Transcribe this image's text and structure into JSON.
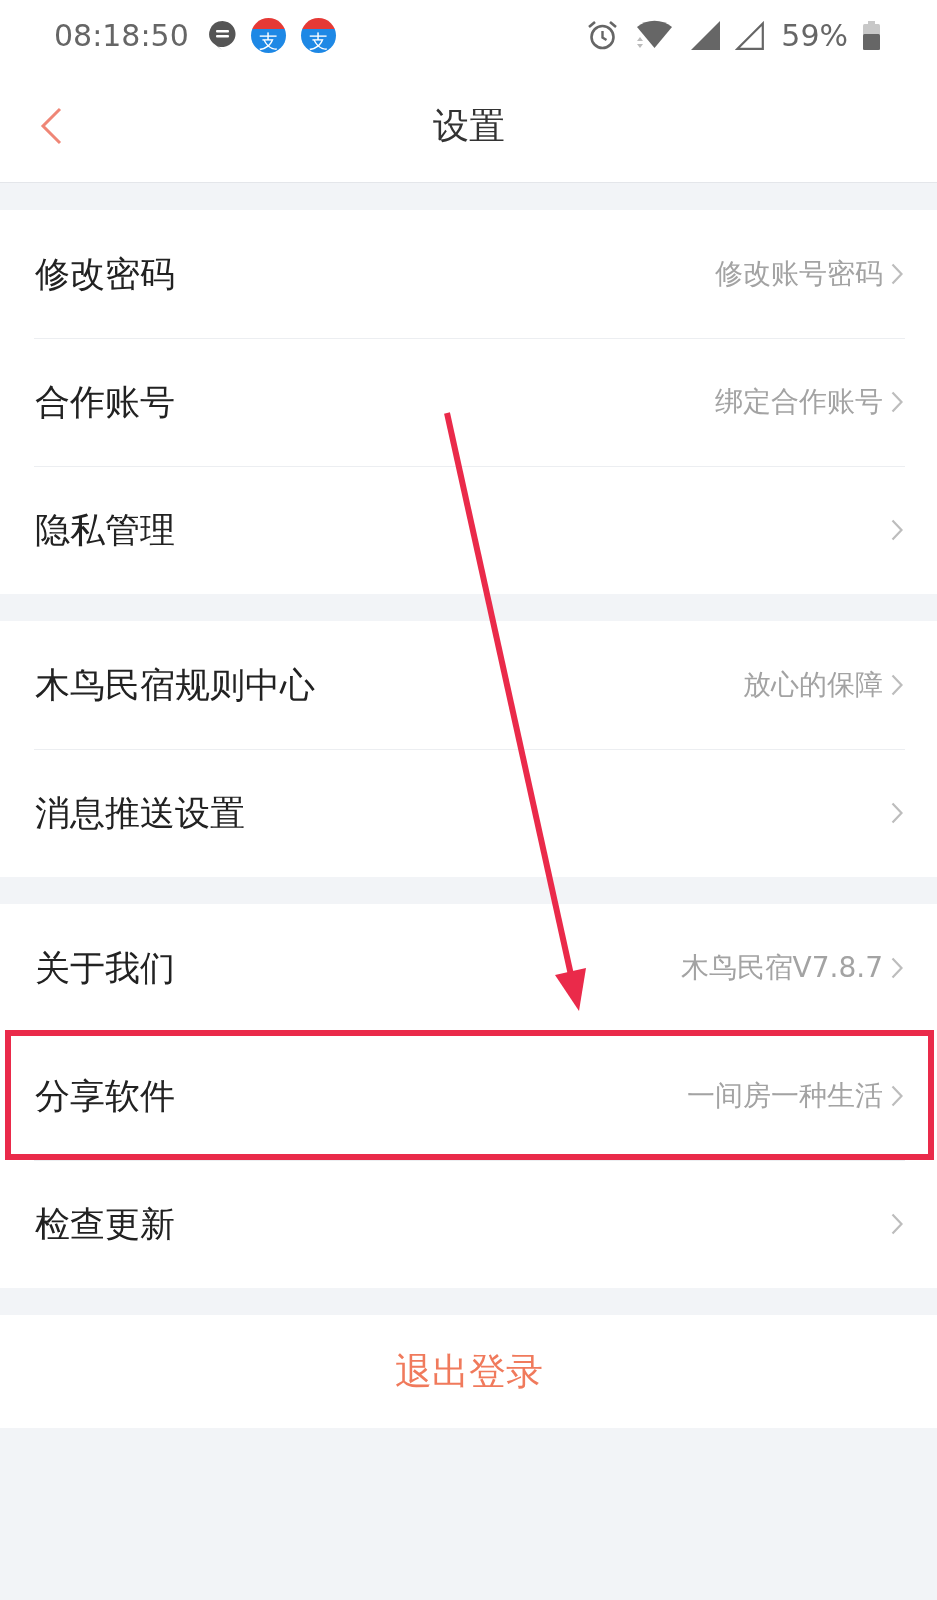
{
  "status_bar": {
    "time": "08:18:50",
    "notifications": [
      {
        "kind": "message"
      },
      {
        "kind": "app",
        "glyph": "支"
      },
      {
        "kind": "app",
        "glyph": "支"
      }
    ],
    "indicators": [
      {
        "kind": "alarm"
      },
      {
        "kind": "wifi"
      },
      {
        "kind": "cell",
        "filled": true
      },
      {
        "kind": "cell",
        "filled": false
      }
    ],
    "battery": "59%"
  },
  "header": {
    "title": "设置"
  },
  "groups": [
    {
      "rows": [
        {
          "label": "修改密码",
          "value": "修改账号密码",
          "highlighted": false
        },
        {
          "label": "合作账号",
          "value": "绑定合作账号",
          "highlighted": false
        },
        {
          "label": "隐私管理",
          "highlighted": false
        }
      ]
    },
    {
      "rows": [
        {
          "label": "木鸟民宿规则中心",
          "value": "放心的保障",
          "highlighted": false
        },
        {
          "label": "消息推送设置",
          "highlighted": false
        }
      ]
    },
    {
      "rows": [
        {
          "label": "关于我们",
          "value": "木鸟民宿V7.8.7",
          "highlighted": false
        },
        {
          "label": "分享软件",
          "value": "一间房一种生活",
          "highlighted": true
        },
        {
          "label": "检查更新",
          "highlighted": false
        }
      ]
    }
  ],
  "logout_button": "退出登录",
  "annotation_arrow": true
}
